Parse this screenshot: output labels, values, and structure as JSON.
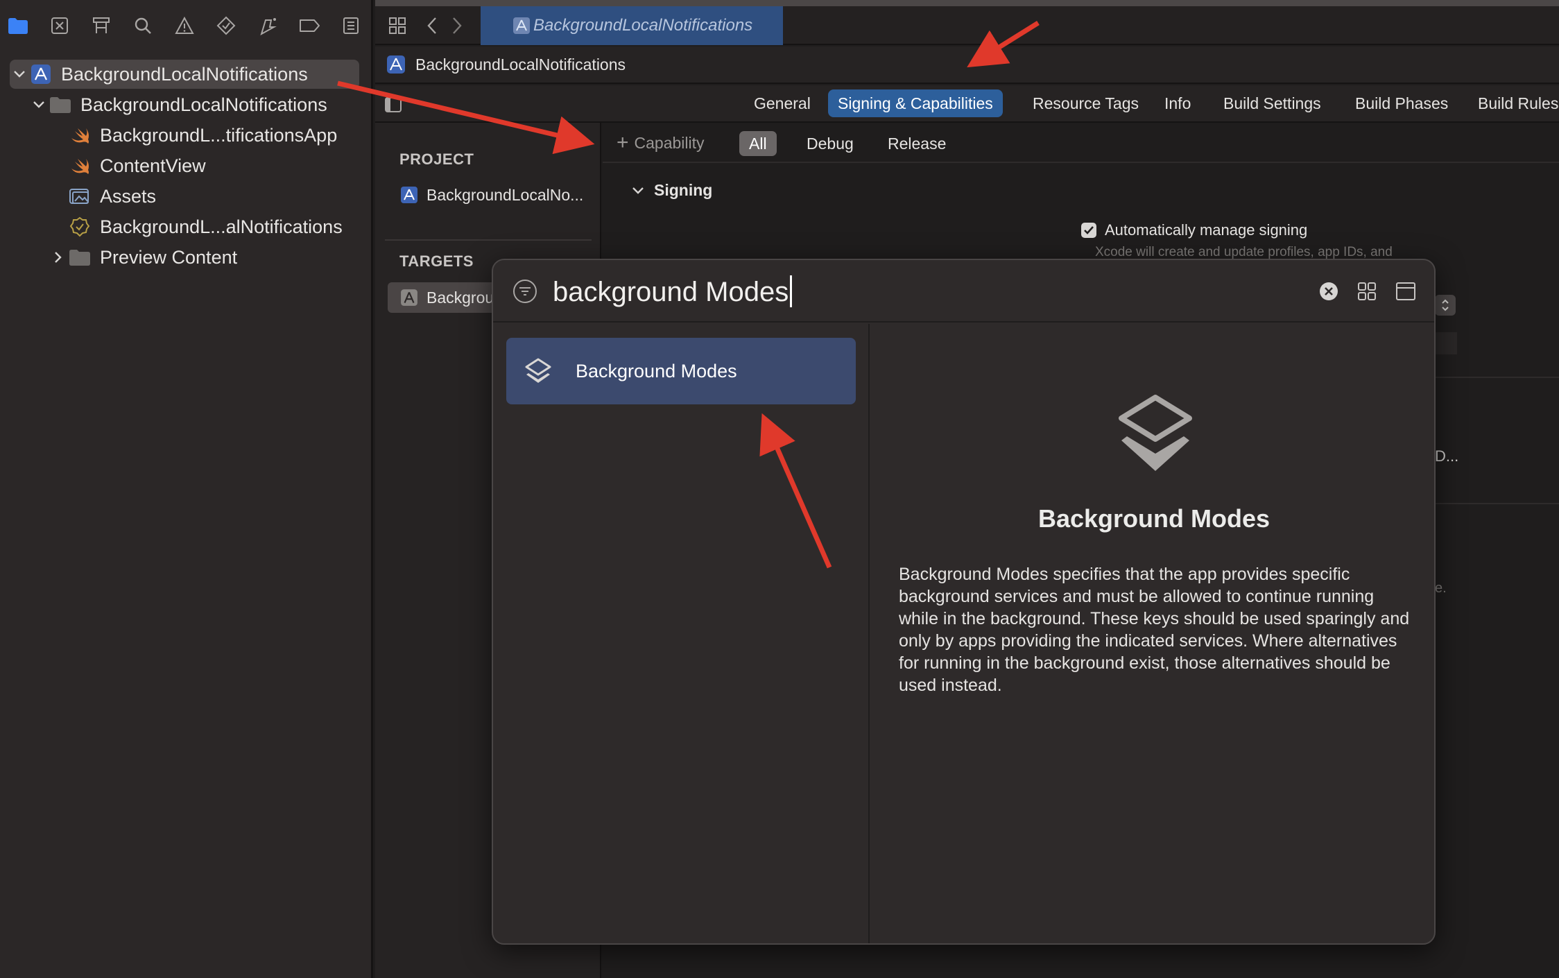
{
  "navigator": {
    "toolbar_icons": [
      "folder-icon",
      "source-control-icon",
      "hierarchy-icon",
      "search-icon",
      "warning-icon",
      "test-icon",
      "debug-icon",
      "breakpoint-icon",
      "report-icon"
    ],
    "tree": [
      {
        "label": "BackgroundLocalNotifications",
        "icon": "project-icon",
        "disclosure": "expanded",
        "selected": true
      },
      {
        "label": "BackgroundLocalNotifications",
        "icon": "folder-icon",
        "disclosure": "expanded"
      },
      {
        "label": "BackgroundL...tificationsApp",
        "icon": "swift-file-icon"
      },
      {
        "label": "ContentView",
        "icon": "swift-file-icon"
      },
      {
        "label": "Assets",
        "icon": "asset-catalog-icon"
      },
      {
        "label": "BackgroundL...alNotifications",
        "icon": "entitlements-icon"
      },
      {
        "label": "Preview Content",
        "icon": "folder-icon",
        "disclosure": "collapsed"
      }
    ]
  },
  "editor": {
    "tab_title": "BackgroundLocalNotifications",
    "jump_bar": "BackgroundLocalNotifications",
    "section_tabs": [
      "General",
      "Signing & Capabilities",
      "Resource Tags",
      "Info",
      "Build Settings",
      "Build Phases",
      "Build Rules"
    ],
    "active_section": "Signing & Capabilities",
    "project_panel": {
      "project_header": "PROJECT",
      "project_item": "BackgroundLocalNo...",
      "targets_header": "TARGETS",
      "target_item": "Backgrou"
    },
    "filter": {
      "capability_label": "Capability",
      "buttons": [
        "All",
        "Debug",
        "Release"
      ],
      "active": "All"
    },
    "signing": {
      "section_title": "Signing",
      "auto_manage_label": "Automatically manage signing",
      "auto_manage_checked": true,
      "auto_manage_note": "Xcode will create and update profiles, app IDs, and",
      "truncated_value": "D...",
      "truncated_note": "e."
    }
  },
  "library": {
    "search_value": "background Modes",
    "results": [
      {
        "label": "Background Modes",
        "icon": "background-modes-icon",
        "selected": true
      }
    ],
    "detail": {
      "title": "Background Modes",
      "description": "Background Modes specifies that the app provides specific background services and must be allowed to continue running while in the background. These keys should be used sparingly and only by apps providing the indicated services. Where alternatives for running in the background exist, those alternatives should be used instead."
    }
  },
  "colors": {
    "accent_blue": "#2d5f9b",
    "selected_result": "#3c4a6e",
    "annotation_arrow": "#e0392b",
    "swift_orange": "#e0803b"
  }
}
